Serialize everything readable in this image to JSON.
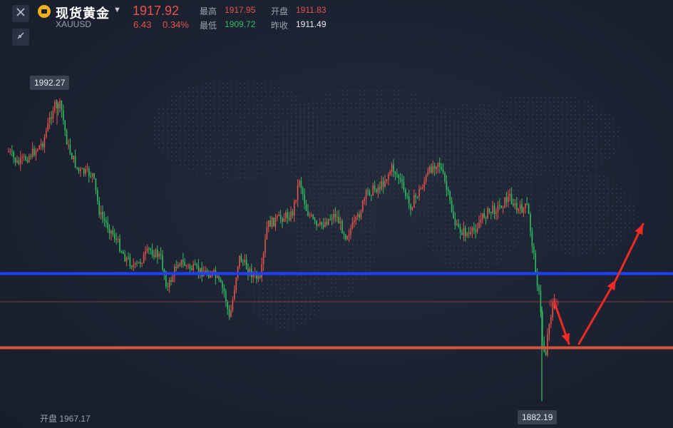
{
  "header": {
    "symbol_name": "现货黄金",
    "symbol_code": "XAUUSD",
    "last_price": "1917.92",
    "change": "6.43",
    "change_pct": "0.34%",
    "high_label": "最高",
    "high_value": "1917.95",
    "low_label": "最低",
    "low_value": "1909.72",
    "open_label": "开盘",
    "open_value": "1911.83",
    "prev_close_label": "昨收",
    "prev_close_value": "1911.49"
  },
  "controls": {
    "close_icon": "close-icon",
    "collapse_icon": "collapse-icon"
  },
  "annotations": {
    "max_label": "1992.27",
    "min_label": "1882.19",
    "bottom_open": "开盘 1967.17"
  },
  "chart_data": {
    "type": "candlestick",
    "high_point": 1992.27,
    "low_point": 1882.19,
    "levels": [
      {
        "name": "blue-support",
        "color": "#1f3fff"
      },
      {
        "name": "red-support",
        "color": "#d9543f"
      }
    ],
    "annotation_arrows_color": "#ee2b24",
    "colors": {
      "up": "#e5534b",
      "down": "#2fbd62"
    }
  }
}
